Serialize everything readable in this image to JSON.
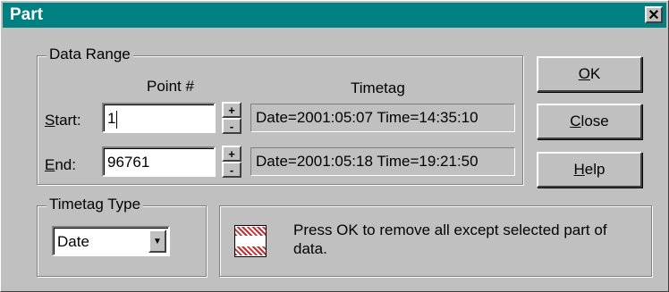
{
  "dialog": {
    "title": "Part",
    "close_glyph": "✕"
  },
  "data_range": {
    "label": "Data Range",
    "point_header": "Point #",
    "timetag_header": "Timetag",
    "start": {
      "label_prefix": "",
      "label_underline": "S",
      "label_rest": "tart:",
      "value": "1",
      "timetag": "Date=2001:05:07 Time=14:35:10"
    },
    "end": {
      "label_prefix": "",
      "label_underline": "E",
      "label_rest": "nd:",
      "value": "96761",
      "timetag": "Date=2001:05:18 Time=19:21:50"
    }
  },
  "spin": {
    "up": "+",
    "down": "-"
  },
  "buttons": {
    "ok": {
      "underline": "O",
      "rest": "K"
    },
    "close": {
      "underline": "C",
      "rest": "lose"
    },
    "help": {
      "underline": "H",
      "rest": "elp"
    }
  },
  "timetag_type": {
    "label": "Timetag Type",
    "selected": "Date",
    "arrow": "▼"
  },
  "info": {
    "icon": "hatched-range-icon",
    "message": "Press OK to remove all except selected part of data."
  }
}
